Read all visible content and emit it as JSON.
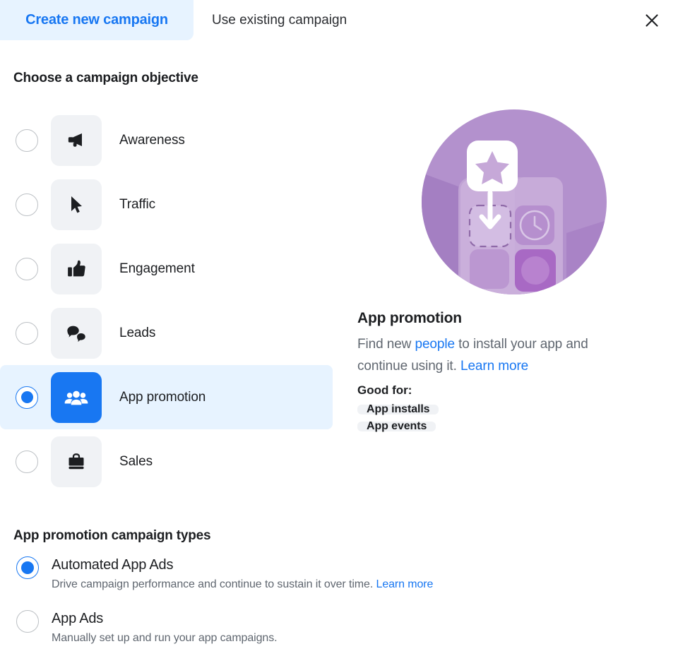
{
  "tabs": {
    "create_new": "Create new campaign",
    "use_existing": "Use existing campaign",
    "close_icon": "close-icon"
  },
  "objective_section": {
    "title": "Choose a campaign objective",
    "options": [
      {
        "label": "Awareness",
        "icon": "megaphone-icon",
        "selected": false
      },
      {
        "label": "Traffic",
        "icon": "cursor-icon",
        "selected": false
      },
      {
        "label": "Engagement",
        "icon": "thumbs-up-icon",
        "selected": false
      },
      {
        "label": "Leads",
        "icon": "chat-bubbles-icon",
        "selected": false
      },
      {
        "label": "App promotion",
        "icon": "people-group-icon",
        "selected": true
      },
      {
        "label": "Sales",
        "icon": "shopping-bag-icon",
        "selected": false
      }
    ]
  },
  "detail": {
    "illustration": "app-promotion-illustration",
    "title": "App promotion",
    "desc_part1": "Find new ",
    "desc_link1": "people",
    "desc_part2": " to install your app and continue using it. ",
    "desc_link2": "Learn more",
    "good_for_label": "Good for:",
    "badges": [
      "App installs",
      "App events"
    ]
  },
  "types_section": {
    "title": "App promotion campaign types",
    "options": [
      {
        "label": "Automated App Ads",
        "desc": "Drive campaign performance and continue to sustain it over time. ",
        "link": "Learn more",
        "selected": true
      },
      {
        "label": "App Ads",
        "desc": "Manually set up and run your app campaigns.",
        "link": "",
        "selected": false
      }
    ]
  },
  "colors": {
    "accent": "#1877f2",
    "selected_row_bg": "#e7f3ff",
    "tile_bg": "#f0f2f5",
    "text_primary": "#1c1e21",
    "text_secondary": "#606770",
    "illustration_purple": "#b391cd"
  }
}
